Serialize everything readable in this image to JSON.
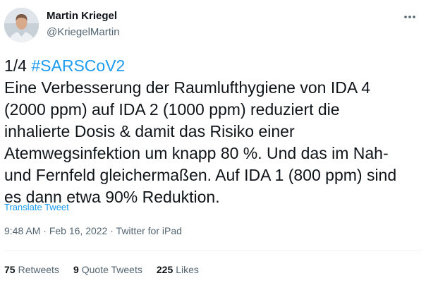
{
  "author": {
    "name": "Martin Kriegel",
    "handle": "@KriegelMartin"
  },
  "tweet": {
    "prefix": "1/4 ",
    "hashtag": "#SARSCoV2",
    "lines": [
      "Eine Verbesserung der Raumlufthygiene von IDA 4",
      "(2000 ppm) auf IDA 2 (1000 ppm) reduziert die",
      "inhalierte Dosis & damit das Risiko einer",
      "Atemwegsinfektion um knapp 80 %. Und das im Nah-",
      "und Fernfeld gleichermaßen. Auf IDA 1 (800 ppm) sind",
      "es dann etwa 90% Reduktion."
    ]
  },
  "translate_label": "Translate Tweet",
  "meta": {
    "time": "9:48 AM",
    "separator": " · ",
    "date": "Feb 16, 2022",
    "source": "Twitter for iPad"
  },
  "stats": {
    "retweets_count": "75",
    "retweets_label": "Retweets",
    "quotes_count": "9",
    "quotes_label": "Quote Tweets",
    "likes_count": "225",
    "likes_label": "Likes"
  },
  "icons": {
    "more": "more-horizontal-icon",
    "avatar": "user-avatar"
  },
  "colors": {
    "link": "#1d9bf0",
    "text": "#0f1419",
    "muted": "#536471",
    "divider": "#eff3f4"
  }
}
